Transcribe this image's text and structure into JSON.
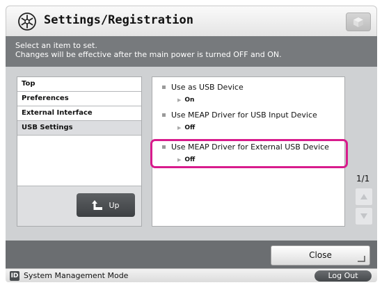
{
  "header": {
    "title": "Settings/Registration",
    "icon": "settings-star-icon",
    "home_icon": "home-cube-icon"
  },
  "info": {
    "line1": "Select an item to set.",
    "line2": "Changes will be effective after the main power is turned OFF and ON."
  },
  "nav": {
    "items": [
      {
        "label": "Top"
      },
      {
        "label": "Preferences"
      },
      {
        "label": "External Interface"
      },
      {
        "label": "USB Settings",
        "selected": true
      }
    ],
    "up_label": "Up",
    "up_icon": "up-arrow-icon"
  },
  "settings": [
    {
      "label": "Use as USB Device",
      "value": "On"
    },
    {
      "label": "Use MEAP Driver for USB Input Device",
      "value": "Off"
    },
    {
      "label": "Use MEAP Driver for External USB Device",
      "value": "Off",
      "highlighted": true
    }
  ],
  "pagination": {
    "indicator": "1/1"
  },
  "footer": {
    "close_label": "Close"
  },
  "status": {
    "badge": "ID",
    "mode": "System Management Mode",
    "logout_label": "Log Out"
  },
  "colors": {
    "highlight": "#d81b8c",
    "info_bar": "#777a7d",
    "body_background": "#cfd1d3"
  }
}
